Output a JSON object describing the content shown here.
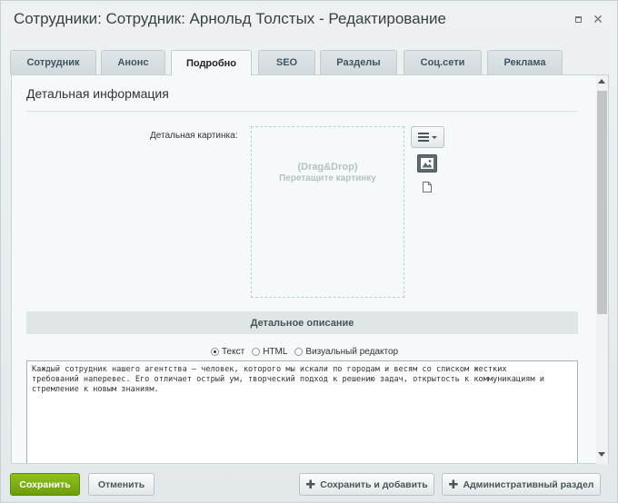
{
  "window": {
    "title": "Сотрудники: Сотрудник: Арнольд Толстых - Редактирование",
    "maximize_icon": "maximize-icon",
    "close_icon": "close-icon",
    "close_glyph": "✕"
  },
  "tabs": [
    {
      "label": "Сотрудник",
      "active": false
    },
    {
      "label": "Анонс",
      "active": false
    },
    {
      "label": "Подробно",
      "active": true
    },
    {
      "label": "SEO",
      "active": false
    },
    {
      "label": "Разделы",
      "active": false
    },
    {
      "label": "Соц.сети",
      "active": false
    },
    {
      "label": "Реклама",
      "active": false
    }
  ],
  "section": {
    "title": "Детальная информация",
    "picture_label": "Детальная картинка:",
    "dropzone_line1": "(Drag&Drop)",
    "dropzone_line2": "Перетащите картинку"
  },
  "description": {
    "header": "Детальное описание",
    "modes": [
      {
        "label": "Текст",
        "checked": true
      },
      {
        "label": "HTML",
        "checked": false
      },
      {
        "label": "Визуальный редактор",
        "checked": false
      }
    ],
    "text": "Каждый сотрудник нашего агентства – человек, которого мы искали по городам и весям со списком жестких\nтребований наперевес. Его отличает острый ум, творческий подход к решению задач, открытость к коммуникациям и\nстремление к новым знаниям."
  },
  "footer": {
    "save_label": "Сохранить",
    "cancel_label": "Отменить",
    "save_add_label": "Сохранить и добавить",
    "admin_label": "Административный раздел",
    "plus_glyph": "✚"
  },
  "colors": {
    "save_button": "#7aaa12",
    "tab_text": "#3f5560",
    "content_bg": "#f5f9f9"
  }
}
